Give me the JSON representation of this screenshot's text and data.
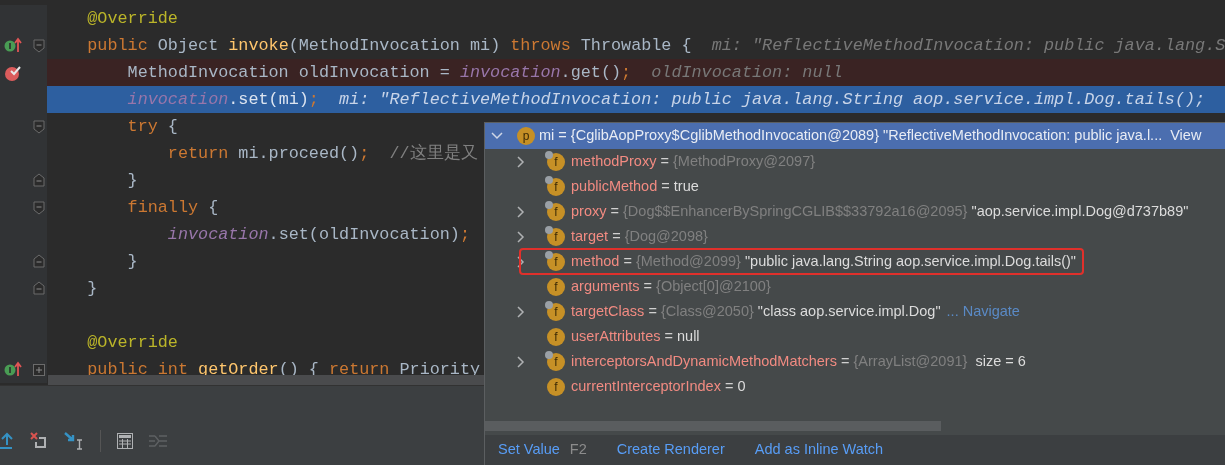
{
  "editor": {
    "lines": [
      {
        "override": false,
        "breakpoint": false,
        "current": false,
        "fold_open": false,
        "fold_close": false,
        "fold_collapsed": false,
        "tokens": [
          {
            "kind": "annotation",
            "text": "    @Override"
          }
        ]
      },
      {
        "override": true,
        "breakpoint": false,
        "current": false,
        "fold_open": true,
        "fold_close": false,
        "fold_collapsed": false,
        "tokens": [
          {
            "kind": "keyword",
            "text": "    public "
          },
          {
            "kind": "plain",
            "text": "Object "
          },
          {
            "kind": "method",
            "text": "invoke"
          },
          {
            "kind": "plain",
            "text": "(MethodInvocation mi) "
          },
          {
            "kind": "keyword",
            "text": "throws "
          },
          {
            "kind": "plain",
            "text": "Throwable {  "
          },
          {
            "kind": "hint",
            "text": "mi: \"ReflectiveMethodInvocation: public java.lang.S"
          }
        ]
      },
      {
        "override": false,
        "breakpoint": true,
        "current": false,
        "fold_open": false,
        "fold_close": false,
        "fold_collapsed": false,
        "tokens": [
          {
            "kind": "plain",
            "text": "        MethodInvocation oldInvocation = "
          },
          {
            "kind": "field",
            "text": "invocation"
          },
          {
            "kind": "plain",
            "text": ".get()"
          },
          {
            "kind": "keyword",
            "text": ";  "
          },
          {
            "kind": "hint",
            "text": "oldInvocation: null"
          }
        ]
      },
      {
        "override": false,
        "breakpoint": false,
        "current": true,
        "fold_open": false,
        "fold_close": false,
        "fold_collapsed": false,
        "tokens": [
          {
            "kind": "field",
            "text": "        invocation"
          },
          {
            "kind": "plain",
            "text": ".set(mi)"
          },
          {
            "kind": "keyword",
            "text": ";  "
          },
          {
            "kind": "hint",
            "text": "mi: \"ReflectiveMethodInvocation: public java.lang.String aop.service.impl.Dog.tails();"
          }
        ]
      },
      {
        "override": false,
        "breakpoint": false,
        "current": false,
        "fold_open": true,
        "fold_close": false,
        "fold_collapsed": false,
        "tokens": [
          {
            "kind": "keyword",
            "text": "        try "
          },
          {
            "kind": "plain",
            "text": "{"
          }
        ]
      },
      {
        "override": false,
        "breakpoint": false,
        "current": false,
        "fold_open": false,
        "fold_close": false,
        "fold_collapsed": false,
        "tokens": [
          {
            "kind": "keyword",
            "text": "            return "
          },
          {
            "kind": "plain",
            "text": "mi.proceed()"
          },
          {
            "kind": "keyword",
            "text": ";  "
          },
          {
            "kind": "comment",
            "text": "//这里是又"
          }
        ]
      },
      {
        "override": false,
        "breakpoint": false,
        "current": false,
        "fold_open": false,
        "fold_close": true,
        "fold_collapsed": false,
        "tokens": [
          {
            "kind": "plain",
            "text": "        }"
          }
        ]
      },
      {
        "override": false,
        "breakpoint": false,
        "current": false,
        "fold_open": true,
        "fold_close": false,
        "fold_collapsed": false,
        "tokens": [
          {
            "kind": "keyword",
            "text": "        finally "
          },
          {
            "kind": "plain",
            "text": "{"
          }
        ]
      },
      {
        "override": false,
        "breakpoint": false,
        "current": false,
        "fold_open": false,
        "fold_close": false,
        "fold_collapsed": false,
        "tokens": [
          {
            "kind": "field",
            "text": "            invocation"
          },
          {
            "kind": "plain",
            "text": ".set(oldInvocation)"
          },
          {
            "kind": "keyword",
            "text": ";"
          }
        ]
      },
      {
        "override": false,
        "breakpoint": false,
        "current": false,
        "fold_open": false,
        "fold_close": true,
        "fold_collapsed": false,
        "tokens": [
          {
            "kind": "plain",
            "text": "        }"
          }
        ]
      },
      {
        "override": false,
        "breakpoint": false,
        "current": false,
        "fold_open": false,
        "fold_close": true,
        "fold_collapsed": false,
        "tokens": [
          {
            "kind": "plain",
            "text": "    }"
          }
        ]
      },
      {
        "override": false,
        "breakpoint": false,
        "current": false,
        "fold_open": false,
        "fold_close": false,
        "fold_collapsed": false
      },
      {
        "override": false,
        "breakpoint": false,
        "current": false,
        "fold_open": false,
        "fold_close": false,
        "fold_collapsed": false,
        "tokens": [
          {
            "kind": "annotation",
            "text": "    @Override"
          }
        ]
      },
      {
        "override": true,
        "breakpoint": false,
        "current": false,
        "fold_open": false,
        "fold_close": false,
        "fold_collapsed": true,
        "tokens": [
          {
            "kind": "keyword",
            "text": "    public int "
          },
          {
            "kind": "method",
            "text": "getOrder"
          },
          {
            "kind": "plain",
            "text": "() { "
          },
          {
            "kind": "keyword",
            "text": "return "
          },
          {
            "kind": "plain",
            "text": "Priority"
          }
        ]
      }
    ]
  },
  "popup": {
    "header": {
      "badge": "p",
      "name": "mi",
      "eq": "=",
      "type": "{CglibAopProxy$CglibMethodInvocation@2089}",
      "value": "\"ReflectiveMethodInvocation: public java.l...",
      "link": "View",
      "expanded": true,
      "selected": true
    },
    "rows": [
      {
        "badge": "f",
        "final": true,
        "expandable": true,
        "outlined": false,
        "name": "methodProxy",
        "eq": "=",
        "type": "{MethodProxy@2097}"
      },
      {
        "badge": "f",
        "final": true,
        "expandable": false,
        "outlined": false,
        "name": "publicMethod",
        "eq": "=",
        "value": "true"
      },
      {
        "badge": "f",
        "final": true,
        "expandable": true,
        "outlined": false,
        "name": "proxy",
        "eq": "=",
        "type": "{Dog$$EnhancerBySpringCGLIB$$33792a16@2095}",
        "value": "\"aop.service.impl.Dog@d737b89\""
      },
      {
        "badge": "f",
        "final": true,
        "expandable": true,
        "outlined": false,
        "name": "target",
        "eq": "=",
        "type": "{Dog@2098}"
      },
      {
        "badge": "f",
        "final": true,
        "expandable": true,
        "outlined": true,
        "name": "method",
        "eq": "=",
        "type": "{Method@2099}",
        "value": "\"public java.lang.String aop.service.impl.Dog.tails()\""
      },
      {
        "badge": "f",
        "final": false,
        "expandable": false,
        "outlined": false,
        "name": "arguments",
        "eq": "=",
        "type": "{Object[0]@2100}"
      },
      {
        "badge": "f",
        "final": true,
        "expandable": true,
        "outlined": false,
        "name": "targetClass",
        "eq": "=",
        "type": "{Class@2050}",
        "value": "\"class aop.service.impl.Dog\"",
        "link": "... Navigate"
      },
      {
        "badge": "f",
        "final": false,
        "expandable": false,
        "outlined": false,
        "name": "userAttributes",
        "eq": "=",
        "value": "null"
      },
      {
        "badge": "f",
        "final": true,
        "expandable": true,
        "outlined": false,
        "name": "interceptorsAndDynamicMethodMatchers",
        "eq": "=",
        "type": "{ArrayList@2091}",
        "value": " size = 6"
      },
      {
        "badge": "f",
        "final": false,
        "expandable": false,
        "outlined": false,
        "name": "currentInterceptorIndex",
        "eq": "=",
        "value": "0"
      }
    ],
    "footer": [
      {
        "label": "Set Value",
        "shortcut": "F2"
      },
      {
        "label": "Create Renderer"
      },
      {
        "label": "Add as Inline Watch"
      }
    ]
  }
}
